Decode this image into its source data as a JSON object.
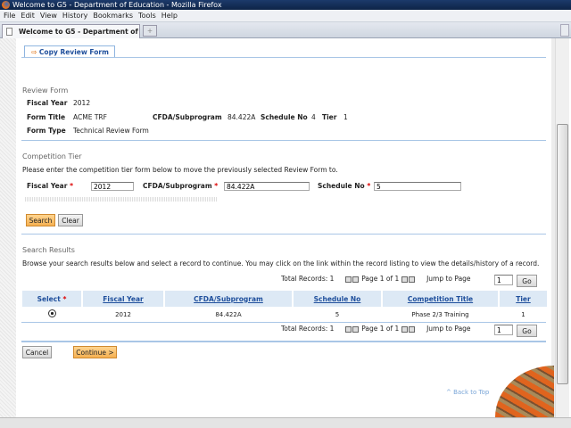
{
  "window": {
    "title": "Welcome to G5 - Department of Education - Mozilla Firefox"
  },
  "menu": [
    "File",
    "Edit",
    "View",
    "History",
    "Bookmarks",
    "Tools",
    "Help"
  ],
  "tab": {
    "label": "Welcome to G5 - Department of Edu...",
    "new_tab": "+"
  },
  "page_tab": "Copy Review Form",
  "review_form": {
    "heading": "Review Form",
    "fiscal_year_label": "Fiscal Year",
    "fiscal_year": "2012",
    "form_title_label": "Form Title",
    "form_title": "ACME TRF",
    "cfda_label": "CFDA/Subprogram",
    "cfda": "84.422A",
    "schedule_label": "Schedule No",
    "schedule": "4",
    "tier_label": "Tier",
    "tier": "1",
    "form_type_label": "Form Type",
    "form_type": "Technical Review Form"
  },
  "competition": {
    "heading": "Competition Tier",
    "instructions": "Please enter the competition tier form below to move the previously selected Review Form to.",
    "fiscal_year_label": "Fiscal Year",
    "fiscal_year": "2012",
    "cfda_label": "CFDA/Subprogram",
    "cfda": "84.422A",
    "schedule_label": "Schedule No",
    "schedule": "5",
    "required": "*",
    "search": "Search",
    "clear": "Clear"
  },
  "results": {
    "heading": "Search Results",
    "instructions": "Browse your search results below and select a record to continue. You may click on the link within the record listing to view the details/history of a record.",
    "total": "Total Records: 1",
    "page": "Page 1 of 1",
    "jump": "Jump to Page",
    "jump_value": "1",
    "go": "Go",
    "columns": [
      "Select",
      "Fiscal Year",
      "CFDA/Subprogram",
      "Schedule No",
      "Competition Title",
      "Tier"
    ],
    "rows": [
      {
        "fiscal_year": "2012",
        "cfda": "84.422A",
        "schedule": "5",
        "title": "Phase 2/3 Training",
        "tier": "1",
        "selected": true
      }
    ]
  },
  "actions": {
    "cancel": "Cancel",
    "continue": "Continue >"
  },
  "back_to_top": "^ Back to Top"
}
